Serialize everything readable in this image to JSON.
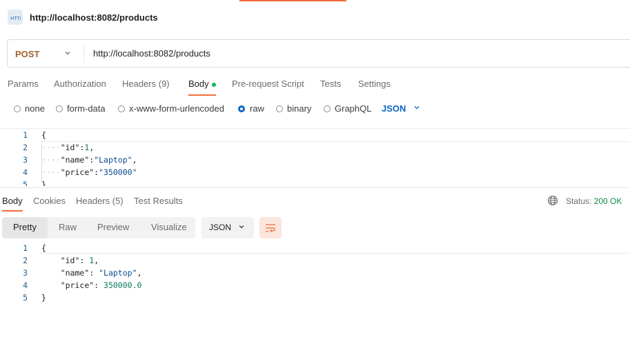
{
  "tab": {
    "icon": "http-icon",
    "icon_text": "HTTP",
    "title": "http://localhost:8082/products"
  },
  "request": {
    "method": "POST",
    "url": "http://localhost:8082/products"
  },
  "request_tabs": [
    {
      "label": "Params"
    },
    {
      "label": "Authorization"
    },
    {
      "label": "Headers (9)"
    },
    {
      "label": "Body"
    },
    {
      "label": "Pre-request Script"
    },
    {
      "label": "Tests"
    },
    {
      "label": "Settings"
    }
  ],
  "active_request_tab": "Body",
  "body_types": [
    {
      "label": "none",
      "selected": false
    },
    {
      "label": "form-data",
      "selected": false
    },
    {
      "label": "x-www-form-urlencoded",
      "selected": false
    },
    {
      "label": "raw",
      "selected": true
    },
    {
      "label": "binary",
      "selected": false
    },
    {
      "label": "GraphQL",
      "selected": false
    }
  ],
  "raw_format": "JSON",
  "request_body_lines": [
    {
      "n": "1",
      "text": "{"
    },
    {
      "n": "2",
      "indent": "····",
      "key": "\"id\"",
      "sep": ":",
      "value": "1",
      "tail": ","
    },
    {
      "n": "3",
      "indent": "····",
      "key": "\"name\"",
      "sep": ":",
      "value": "\"Laptop\"",
      "tail": ","
    },
    {
      "n": "4",
      "indent": "····",
      "key": "\"price\"",
      "sep": ":",
      "value": "\"350000\"",
      "tail": ""
    },
    {
      "n": "5",
      "text": "}"
    }
  ],
  "response_tabs": [
    {
      "label": "Body"
    },
    {
      "label": "Cookies"
    },
    {
      "label": "Headers (5)"
    },
    {
      "label": "Test Results"
    }
  ],
  "status": {
    "label": "Status:",
    "value": "200 OK"
  },
  "response_view_modes": [
    "Pretty",
    "Raw",
    "Preview",
    "Visualize"
  ],
  "response_format": "JSON",
  "response_body_lines": [
    {
      "n": "1",
      "text": "{"
    },
    {
      "n": "2",
      "indent": "    ",
      "key": "\"id\"",
      "sep": ": ",
      "value": "1",
      "tail": ","
    },
    {
      "n": "3",
      "indent": "    ",
      "key": "\"name\"",
      "sep": ": ",
      "value": "\"Laptop\"",
      "tail": ","
    },
    {
      "n": "4",
      "indent": "    ",
      "key": "\"price\"",
      "sep": ": ",
      "value": "350000.0",
      "tail": ""
    },
    {
      "n": "5",
      "text": "}"
    }
  ],
  "colors": {
    "accent": "#f26b3a",
    "method": "#a0622f",
    "link": "#0a66c2",
    "status_ok": "#0b8a4a"
  }
}
